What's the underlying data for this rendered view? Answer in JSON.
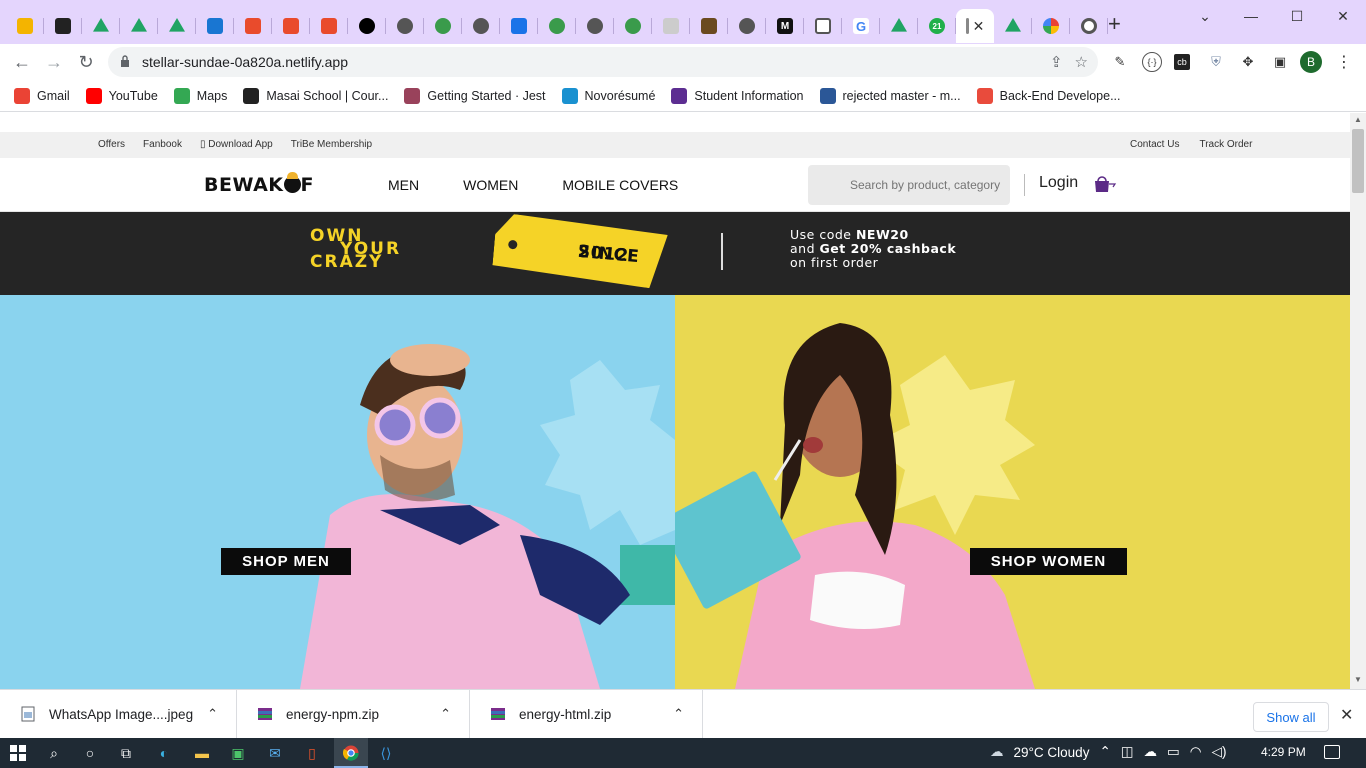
{
  "browser": {
    "url": "stellar-sundae-0a820a.netlify.app",
    "profile_initial": "B",
    "new_tab_symbol": "+",
    "tab_close_symbol": "✕",
    "window_controls": [
      "⌄",
      "—",
      "☐",
      "✕"
    ],
    "tab_count_badge": "21",
    "bookmarks": [
      {
        "label": "Gmail",
        "icon": "gmail-icon",
        "color": "#ea4335"
      },
      {
        "label": "YouTube",
        "icon": "youtube-icon",
        "color": "#ff0000"
      },
      {
        "label": "Maps",
        "icon": "maps-icon",
        "color": "#34a853"
      },
      {
        "label": "Masai School | Cour...",
        "icon": "masai-icon",
        "color": "#222222"
      },
      {
        "label": "Getting Started · Jest",
        "icon": "jest-icon",
        "color": "#99425b"
      },
      {
        "label": "Novorésumé",
        "icon": "novoresume-icon",
        "color": "#1a91d0"
      },
      {
        "label": "Student Information",
        "icon": "student-info-icon",
        "color": "#5c2d91"
      },
      {
        "label": "rejected master - m...",
        "icon": "e-icon",
        "color": "#2b5797"
      },
      {
        "label": "Back-End Develope...",
        "icon": "backend-icon",
        "color": "#e94b3c"
      }
    ]
  },
  "site": {
    "top_links_left": [
      "Offers",
      "Fanbook",
      "▯ Download App",
      "TriBe Membership"
    ],
    "top_links_right": [
      "Contact Us",
      "Track Order"
    ],
    "logo": "BEWAK  F",
    "nav": [
      "MEN",
      "WOMEN",
      "MOBILE COVERS"
    ],
    "search_placeholder": "Search by product, category",
    "login": "Login",
    "promo": {
      "own_lines": [
        "OWN",
        "YOUR",
        "CRAZY"
      ],
      "since_lines": [
        "SINCE",
        "2012"
      ],
      "code_line1_pre": "Use code ",
      "code_value": "NEW20",
      "code_line2_pre": "and ",
      "code_line2_bold": "Get 20% cashback",
      "code_line3": "on first order"
    },
    "hero_men_button": "SHOP MEN",
    "hero_women_button": "SHOP WOMEN"
  },
  "downloads": {
    "items": [
      {
        "name": "WhatsApp Image....jpeg"
      },
      {
        "name": "energy-npm.zip"
      },
      {
        "name": "energy-html.zip"
      }
    ],
    "show_all": "Show all",
    "close": "✕",
    "chevron": "⌃"
  },
  "taskbar": {
    "weather": "29°C  Cloudy",
    "time": "4:29 PM"
  },
  "colors": {
    "tabstrip": "#e4d5fd",
    "promo_bg": "#252525",
    "promo_yellow": "#f5d327",
    "hero_men_bg": "#8ad3ee",
    "hero_women_bg": "#e9d851"
  }
}
